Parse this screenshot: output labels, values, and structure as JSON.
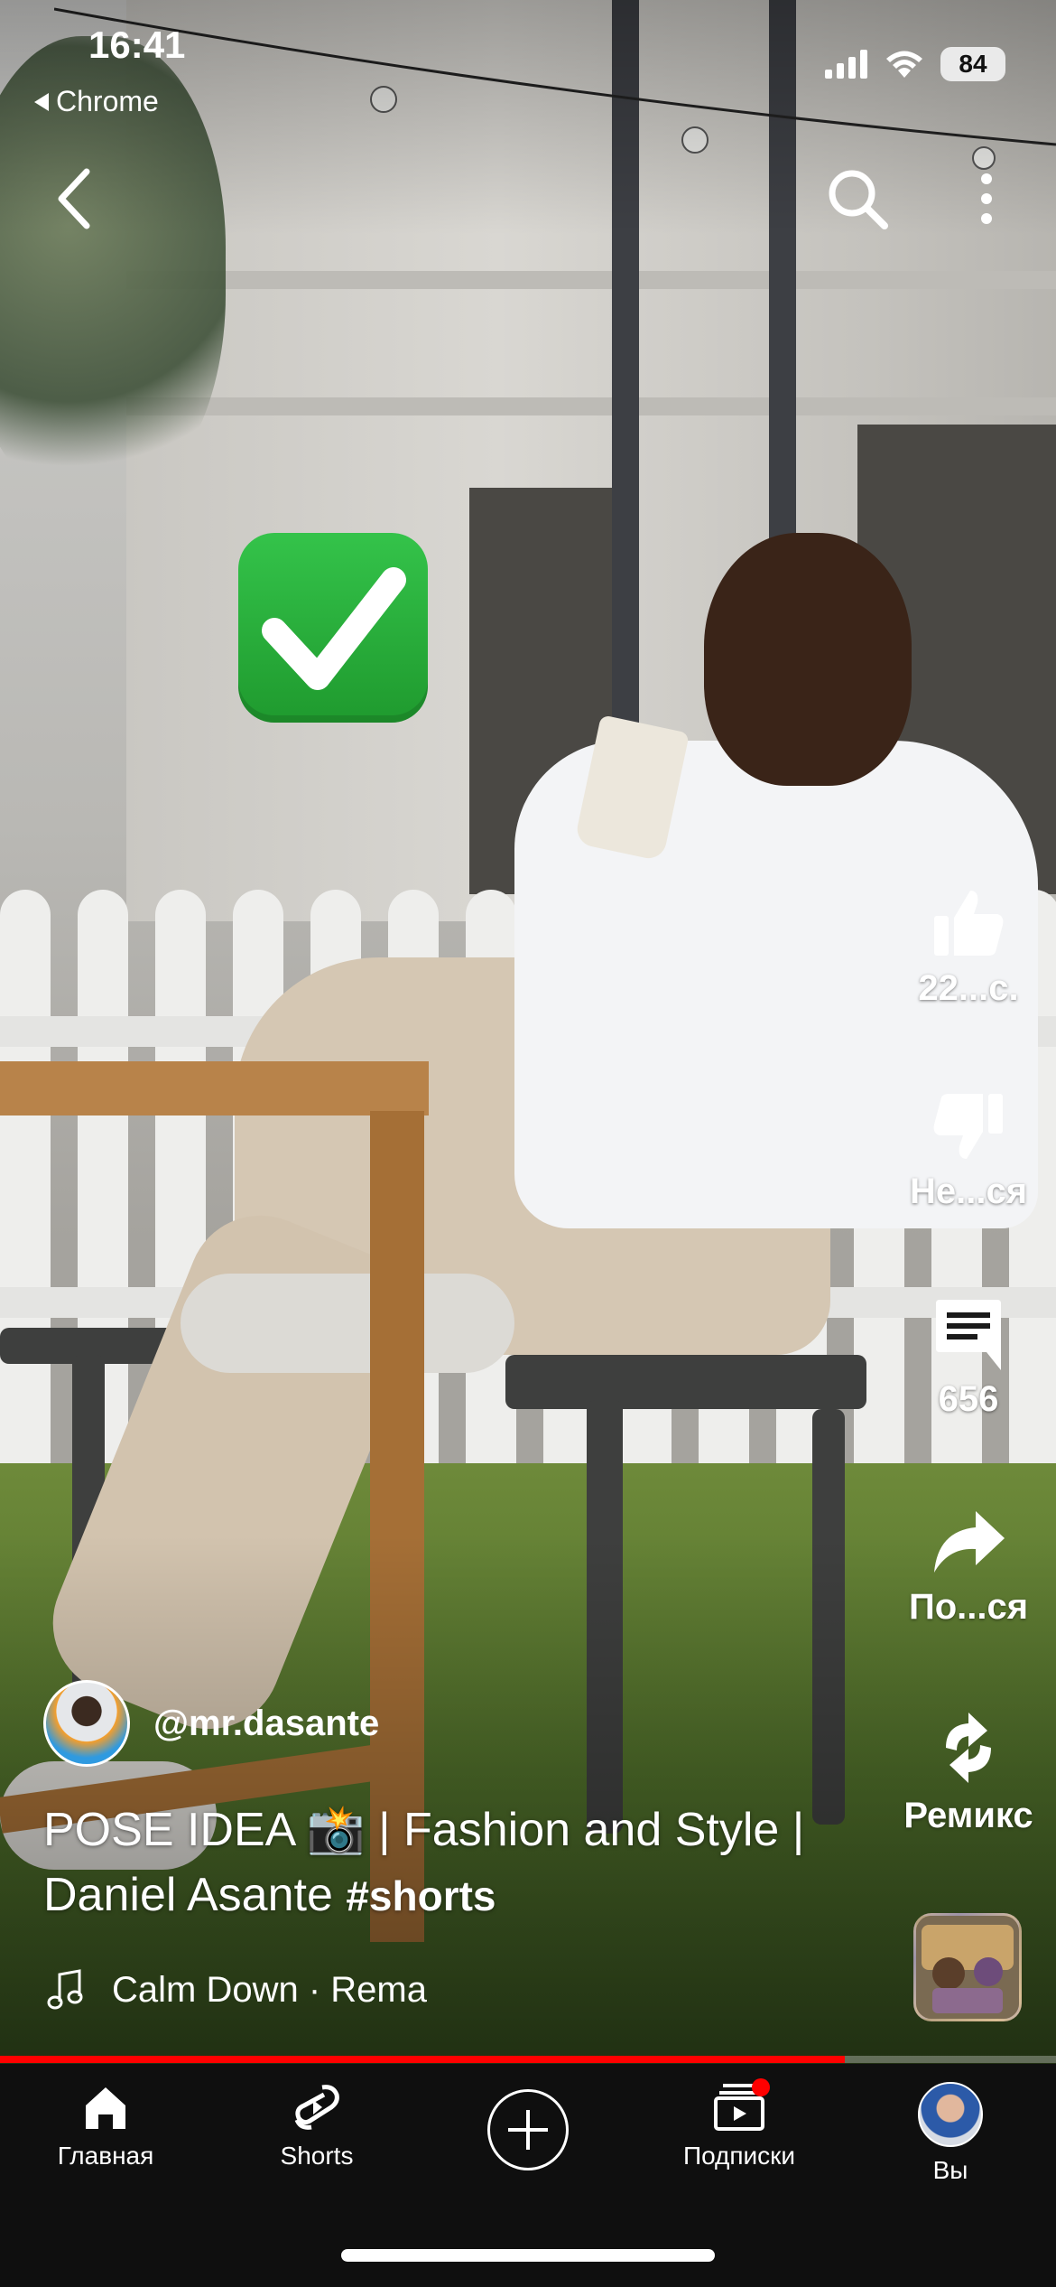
{
  "status_bar": {
    "time": "16:41",
    "back_app": "Chrome",
    "battery": "84"
  },
  "top_bar": {
    "back_icon": "chevron-left-icon",
    "search_icon": "search-icon",
    "more_icon": "more-vert-icon"
  },
  "sticker": {
    "icon": "check-mark-emoji"
  },
  "actions": {
    "like": {
      "label": "22...с.",
      "icon": "thumb-up-icon"
    },
    "dislike": {
      "label": "Не...ся",
      "icon": "thumb-down-icon"
    },
    "comments": {
      "label": "656",
      "icon": "comment-icon"
    },
    "share": {
      "label": "По...ся",
      "icon": "share-icon"
    },
    "remix": {
      "label": "Ремикс",
      "icon": "remix-icon"
    }
  },
  "video": {
    "channel": "@mr.dasante",
    "title": "POSE IDEA 📸 | Fashion and Style | Daniel Asante",
    "hashtag": "#shorts",
    "music": "Calm Down · Rema",
    "progress_fraction": 0.8
  },
  "nav": {
    "home": "Главная",
    "shorts": "Shorts",
    "subscriptions": "Подписки",
    "you": "Вы"
  },
  "colors": {
    "accent_red": "#ff0000",
    "nav_bg": "#0f0f0f"
  }
}
